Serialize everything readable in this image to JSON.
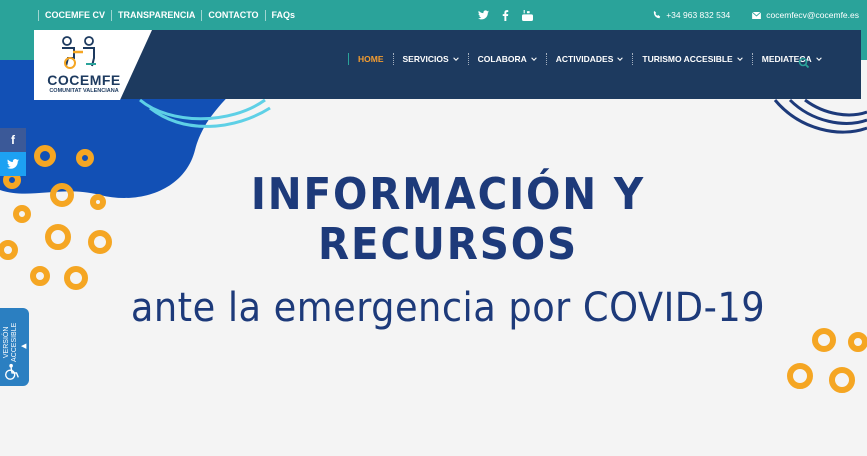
{
  "topbar": {
    "links": [
      "COCEMFE CV",
      "TRANSPARENCIA",
      "CONTACTO",
      "FAQs"
    ],
    "social_icons": [
      "twitter-icon",
      "facebook-icon",
      "youtube-icon"
    ],
    "phone": "+34 963 832 534",
    "email": "cocemfecv@cocemfe.es"
  },
  "logo": {
    "name": "COCEMFE",
    "subtitle": "COMUNITAT VALENCIANA"
  },
  "nav": {
    "items": [
      {
        "label": "HOME",
        "active": true,
        "dropdown": false
      },
      {
        "label": "SERVICIOS",
        "active": false,
        "dropdown": true
      },
      {
        "label": "COLABORA",
        "active": false,
        "dropdown": true
      },
      {
        "label": "ACTIVIDADES",
        "active": false,
        "dropdown": true
      },
      {
        "label": "TURISMO ACCESIBLE",
        "active": false,
        "dropdown": true
      },
      {
        "label": "MEDIATECA",
        "active": false,
        "dropdown": true
      }
    ],
    "search_icon": "search-icon"
  },
  "share": {
    "facebook_label": "f"
  },
  "accessible_tab": {
    "label": "VERSIÓN\nACCESIBLE"
  },
  "hero": {
    "title_line1": "INFORMACIÓN Y",
    "title_line2": "RECURSOS",
    "subtitle": "ante la emergencia por COVID-19"
  },
  "colors": {
    "teal": "#2aa39a",
    "navy": "#1d3a5f",
    "blue": "#1250b5",
    "orange": "#f5a623",
    "headline": "#1d3a7a"
  }
}
